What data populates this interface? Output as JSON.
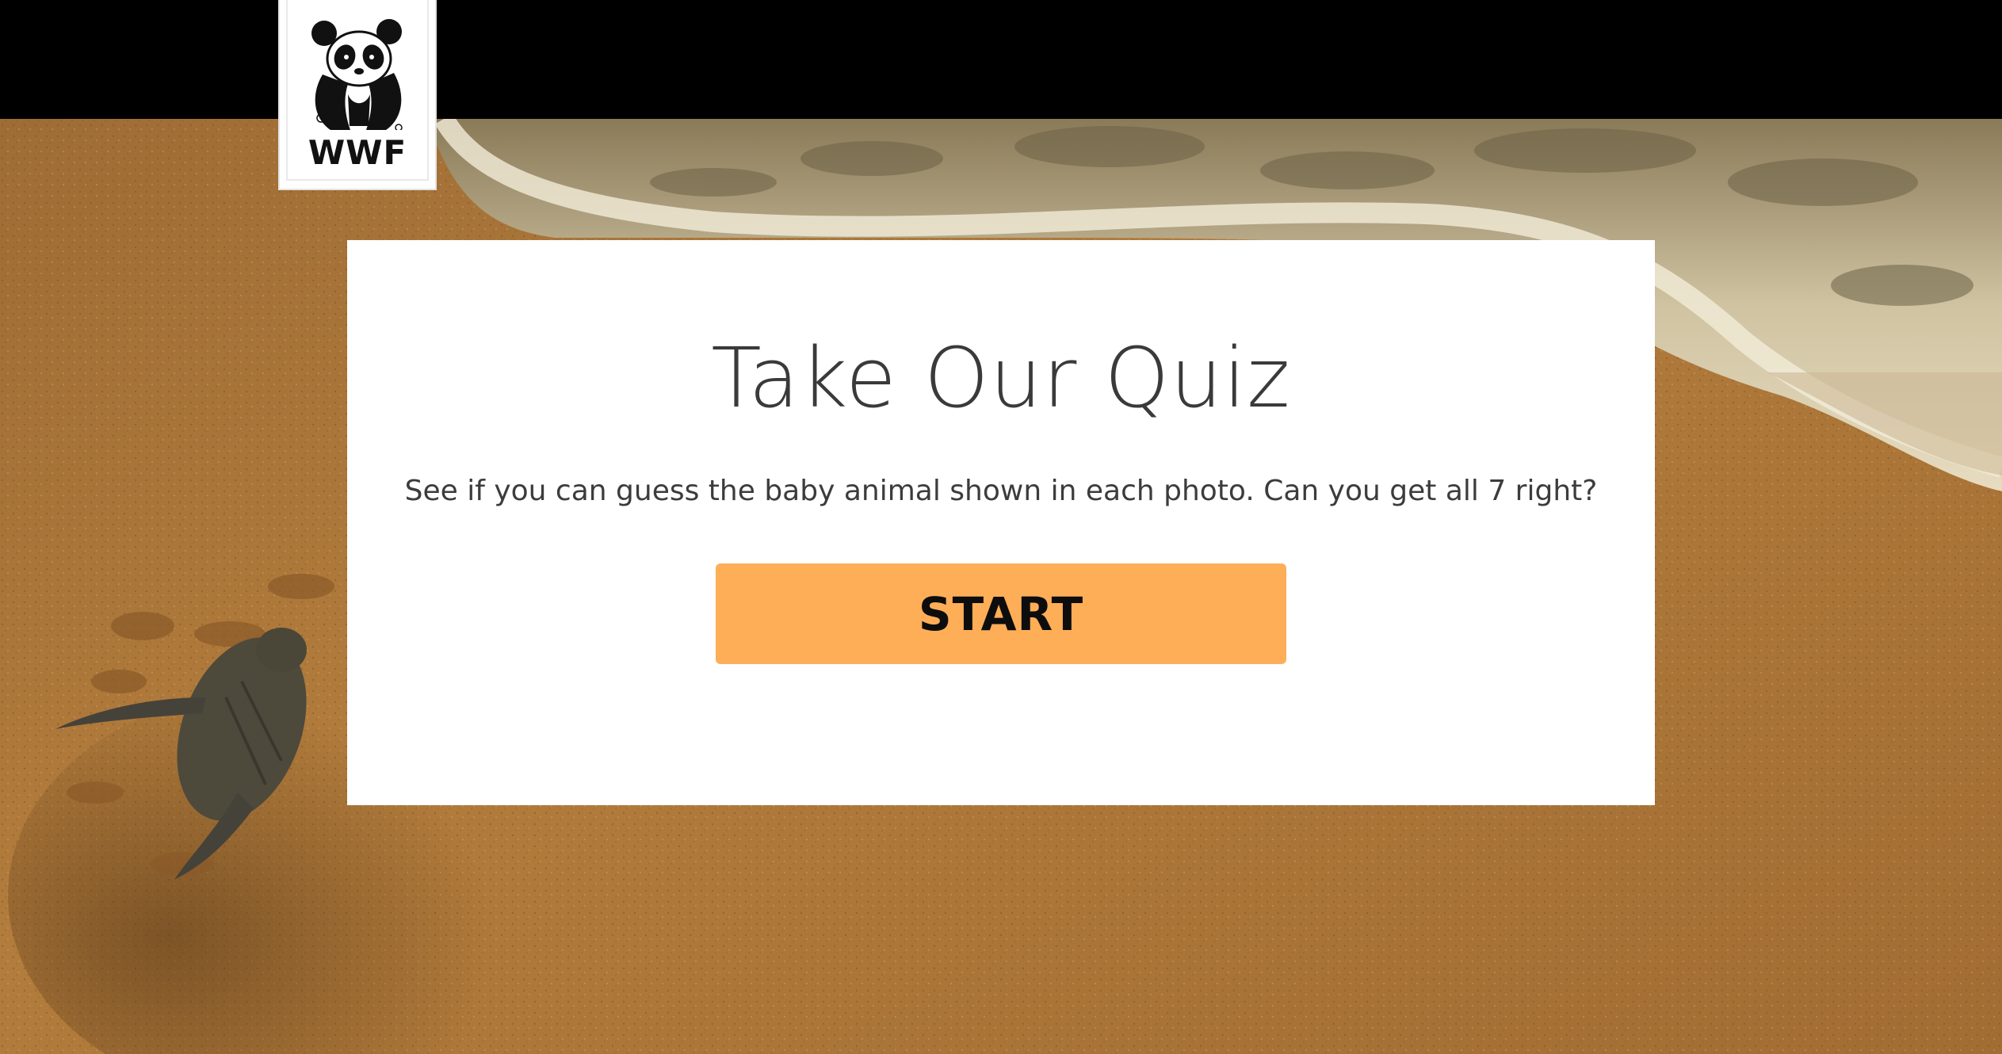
{
  "logo": {
    "text": "WWF",
    "icon": "panda-icon"
  },
  "quiz": {
    "title": "Take Our Quiz",
    "description": "See if you can guess the baby animal shown in each photo. Can you get all 7 right?",
    "start_label": "START"
  },
  "background": {
    "scene": "sea-turtle-hatchling-on-beach",
    "colors": {
      "sand": "#b07a3c",
      "foam": "#d9cfb4",
      "topbar": "#000000",
      "button": "#fdae57"
    }
  }
}
